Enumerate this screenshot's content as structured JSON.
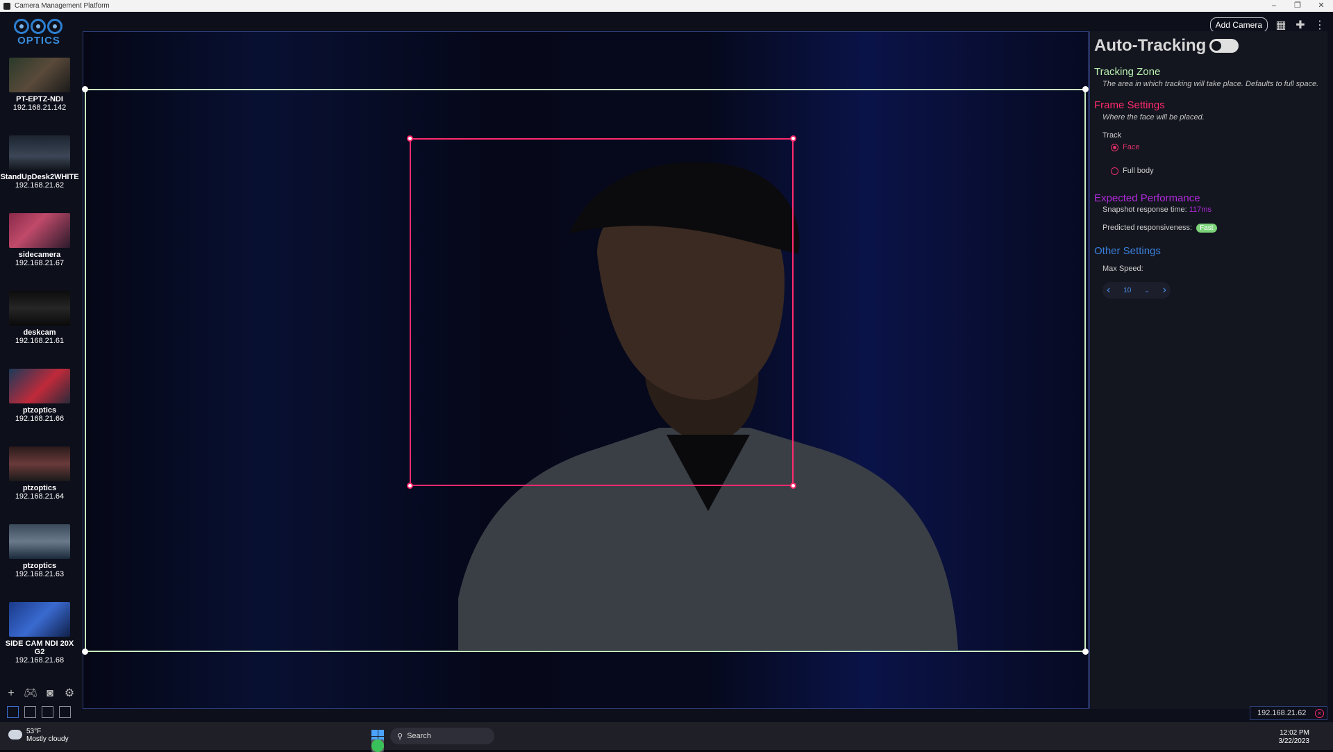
{
  "window": {
    "title": "Camera Management Platform"
  },
  "logo": {
    "text": "OPTICS"
  },
  "cameras": [
    {
      "name": "PT-EPTZ-NDI",
      "ip": "192.168.21.142"
    },
    {
      "name": "StandUpDesk2WHITE",
      "ip": "192.168.21.62"
    },
    {
      "name": "sidecamera",
      "ip": "192.168.21.67"
    },
    {
      "name": "deskcam",
      "ip": "192.168.21.61"
    },
    {
      "name": "ptzoptics",
      "ip": "192.168.21.66"
    },
    {
      "name": "ptzoptics",
      "ip": "192.168.21.64"
    },
    {
      "name": "ptzoptics",
      "ip": "192.168.21.63"
    },
    {
      "name": "SIDE CAM NDI 20X G2",
      "ip": "192.168.21.68"
    }
  ],
  "toolbar": {
    "add_camera": "Add Camera"
  },
  "panel": {
    "title": "Auto-Tracking",
    "toggle_on": false,
    "tracking_zone": {
      "title": "Tracking Zone",
      "desc": "The area in which tracking will take place. Defaults to full space."
    },
    "frame_settings": {
      "title": "Frame Settings",
      "desc": "Where the face will be placed.",
      "track_label": "Track",
      "options": [
        "Face",
        "Full body"
      ],
      "selected": "Face"
    },
    "performance": {
      "title": "Expected Performance",
      "snapshot_label": "Snapshot response time:",
      "snapshot_value": "117ms",
      "responsiveness_label": "Predicted responsiveness:",
      "responsiveness_value": "Fast"
    },
    "other": {
      "title": "Other Settings",
      "max_speed_label": "Max Speed:",
      "max_speed_value": "10"
    }
  },
  "selected_ip": "192.168.21.62",
  "taskbar": {
    "weather_temp": "53°F",
    "weather_desc": "Mostly cloudy",
    "search": "Search",
    "time": "12:02 PM",
    "date": "3/22/2023"
  },
  "colors": {
    "zone": "#c8f0c0",
    "frame": "#ff2a6d",
    "tracking_zone_title": "#b8f0b0",
    "frame_settings_title": "#ff2a6d",
    "performance_title": "#b02adb",
    "other_title": "#3a7fd9",
    "accent_blue": "#4b8de8"
  },
  "icons": {
    "minimize": "minimize-icon",
    "maximize": "maximize-icon",
    "close": "close-icon",
    "grid": "grid-icon",
    "joystick": "joystick-icon",
    "more": "more-vertical-icon",
    "add": "plus-icon",
    "gamepad": "gamepad-icon",
    "camera": "camera-icon",
    "settings": "gear-icon"
  }
}
